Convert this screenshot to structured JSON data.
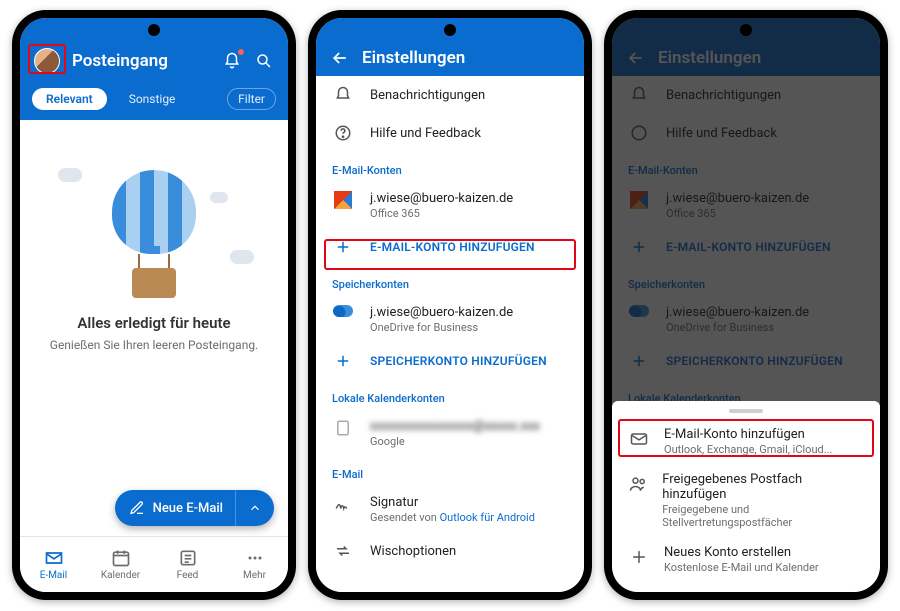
{
  "colors": {
    "brand": "#0a6cce",
    "highlight": "#e30613"
  },
  "phone1": {
    "header": {
      "title": "Posteingang"
    },
    "tabs": {
      "active": "Relevant",
      "other": "Sonstige",
      "filter": "Filter"
    },
    "empty": {
      "title": "Alles erledigt für heute",
      "sub": "Genießen Sie Ihren leeren Posteingang."
    },
    "fab": {
      "label": "Neue E-Mail"
    },
    "bottom": [
      {
        "label": "E-Mail"
      },
      {
        "label": "Kalender"
      },
      {
        "label": "Feed"
      },
      {
        "label": "Mehr"
      }
    ]
  },
  "phone2": {
    "header": {
      "title": "Einstellungen"
    },
    "items": {
      "notifications": "Benachrichtigungen",
      "help": "Hilfe und Feedback"
    },
    "section_accounts": "E-Mail-Konten",
    "account1": {
      "email": "j.wiese@buero-kaizen.de",
      "type": "Office 365"
    },
    "add_account": "E-MAIL-KONTO HINZUFÜGEN",
    "section_storage": "Speicherkonten",
    "storage1": {
      "email": "j.wiese@buero-kaizen.de",
      "type": "OneDrive for Business"
    },
    "add_storage": "SPEICHERKONTO HINZUFÜGEN",
    "section_local": "Lokale Kalenderkonten",
    "local1": {
      "type": "Google"
    },
    "section_email": "E-Mail",
    "signature": {
      "title": "Signatur",
      "sub_prefix": "Gesendet von ",
      "sub_link": "Outlook für Android"
    },
    "swipe": "Wischoptionen"
  },
  "phone3": {
    "sheet": [
      {
        "title": "E-Mail-Konto hinzufügen",
        "sub": "Outlook, Exchange, Gmail, iCloud..."
      },
      {
        "title": "Freigegebenes Postfach hinzufügen",
        "sub": "Freigegebene und Stellvertretungspostfächer"
      },
      {
        "title": "Neues Konto erstellen",
        "sub": "Kostenlose E-Mail und Kalender"
      }
    ]
  }
}
